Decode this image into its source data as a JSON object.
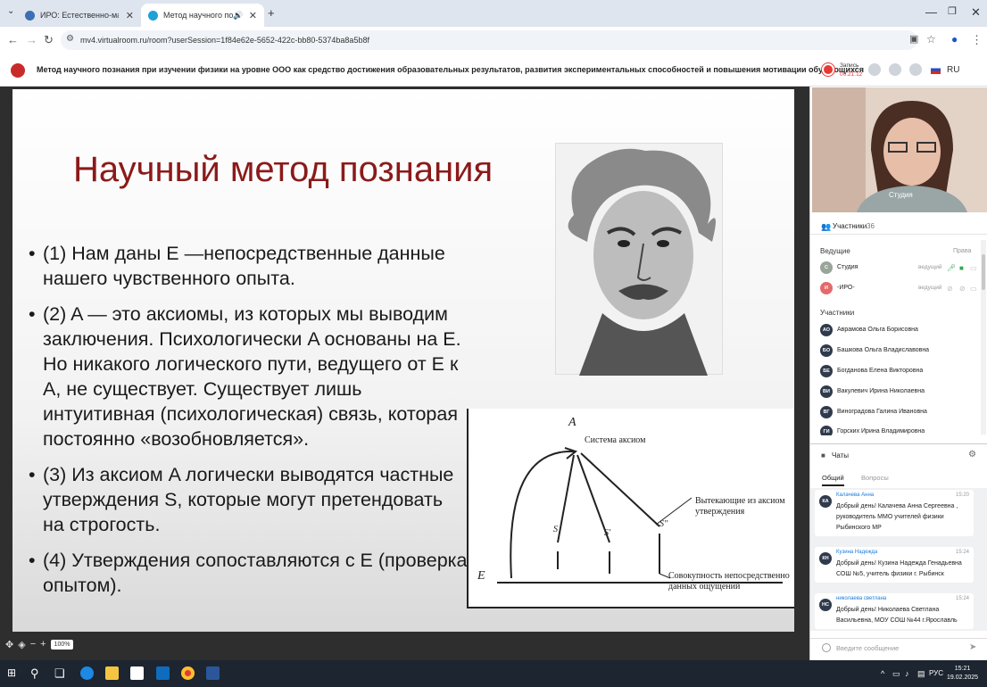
{
  "browser": {
    "tabs": [
      {
        "title": "ИРО: Естественно-математич",
        "favicon_color": "#3c6fb5"
      },
      {
        "title": "Метод научного познания пр",
        "favicon_color": "#1ea0d8"
      }
    ],
    "url": "mv4.virtualroom.ru/room?userSession=1f84e62e-5652-422c-bb80-5374ba8a5b8f"
  },
  "header": {
    "title": "Метод научного познания при изучении физики на уровне ООО как средство достижения образовательных результатов, развития экспериментальных способностей и повышения мотивации обучающихся",
    "record_label": "Запись",
    "record_time": "00:21:12",
    "language": "RU"
  },
  "slide": {
    "title": "Научный метод познания",
    "bullets": [
      "(1) Нам даны E —непосредственные данные нашего чувственного опыта.",
      "(2) A — это аксиомы, из которых мы выводим заключения. Психологически A основаны на E. Но никакого логического пути, ведущего от E к A, не существует. Существует лишь интуитивная (психологическая) связь, которая постоянно «возобновляется».",
      "(3) Из аксиом A логически выводятся частные утверждения S, которые могут претендовать на строгость.",
      "(4) Утверждения сопоставляются с E (проверка опытом)."
    ],
    "diagram": {
      "axioms_label": "Система аксиом",
      "derived_label": "Вытекающие из аксиом утверждения",
      "experience_label": "Совокупность непосредственно данных ощущений",
      "letter_a": "A",
      "letter_e": "E",
      "s_labels": [
        "S",
        "S'",
        "S''"
      ]
    },
    "zoom": "100%"
  },
  "video": {
    "name": "Студия"
  },
  "participants": {
    "title": "Участники",
    "count": "36",
    "hosts_title": "Ведущие",
    "rights_label": "Права",
    "hosts": [
      {
        "initials": "С",
        "name": "Студия",
        "role": "ведущий",
        "color": "#9aa59a"
      },
      {
        "initials": "И",
        "name": "-ИРО-",
        "role": "ведущий",
        "color": "#e46a6a"
      }
    ],
    "members_title": "Участники",
    "members": [
      {
        "initials": "АО",
        "name": "Аврамова Ольга Борисовна"
      },
      {
        "initials": "БО",
        "name": "Башкова Ольга Владиславовна"
      },
      {
        "initials": "БЕ",
        "name": "Богданова Елена Викторовна"
      },
      {
        "initials": "ВИ",
        "name": "Вакулевич Ирина Николаевна"
      },
      {
        "initials": "ВГ",
        "name": "Виноградова Галина Ивановна"
      },
      {
        "initials": "ГИ",
        "name": "Горских Ирина Владимировна"
      }
    ]
  },
  "chats": {
    "title": "Чаты",
    "tabs": [
      "Общий",
      "Вопросы"
    ],
    "messages": [
      {
        "initials": "КА",
        "name": "Калачева Анна",
        "time": "15:20",
        "text": "Добрый день! Калачева Анна Сергеевна , руководитель ММО учителей физики Рыбинского МР"
      },
      {
        "initials": "КН",
        "name": "Кузина Надежда",
        "time": "15:24",
        "text": "Добрый день! Кузина Надежда Генадьевна СОШ №5, учитель физики г. Рыбинск"
      },
      {
        "initials": "НС",
        "name": "николаева светлана",
        "time": "15:24",
        "text": "Добрый день! Николаева Светлана Васильевна, МОУ СОШ №44 г.Ярославль"
      }
    ],
    "input_placeholder": "Введите сообщение"
  },
  "taskbar": {
    "lang": "РУС",
    "time": "15:21",
    "date": "19.02.2025"
  }
}
